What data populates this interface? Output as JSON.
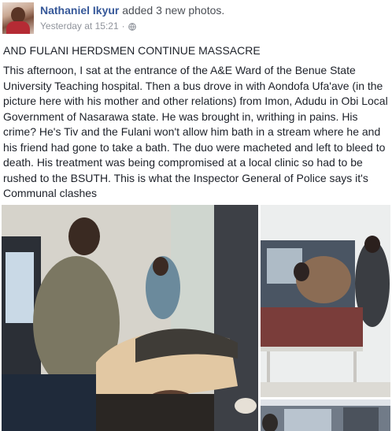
{
  "post": {
    "author": "Nathaniel Ikyur",
    "action": "added 3 new photos.",
    "timestamp": "Yesterday at 15:21",
    "separator": "·",
    "privacy_icon": "globe-icon",
    "headline": "AND FULANI HERDSMEN CONTINUE MASSACRE",
    "body": "This afternoon, I sat at the entrance of the A&E Ward of the Benue State University Teaching hospital. Then a bus drove in with Aondofa Ufa'ave (in the picture here with his mother and other relations) from Imon, Adudu in Obi Local Government of Nasarawa state. He was brought in, writhing in pains. His crime? He's Tiv and the Fulani won't allow him bath in a stream where he and his friend had gone to take a bath. The duo were macheted and left to bleed to death. His treatment was being compromised at a local clinic so had to be rushed to the BSUTH. This is what the Inspector General of Police says it's Communal clashes"
  },
  "colors": {
    "author_link": "#365899",
    "text": "#1d2129",
    "meta": "#90949c"
  }
}
